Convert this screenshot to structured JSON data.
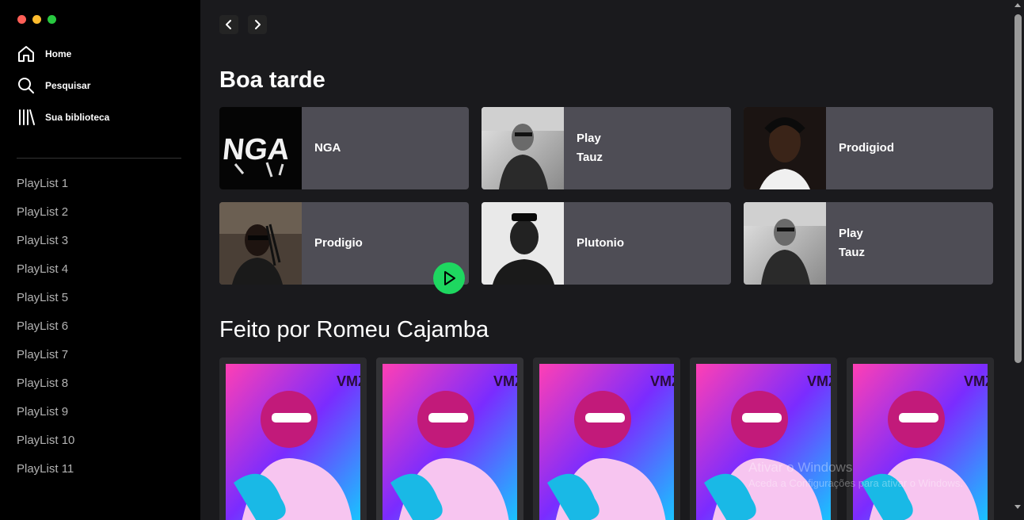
{
  "window": {
    "controls": [
      "close",
      "minimize",
      "maximize"
    ]
  },
  "sidebar": {
    "nav": [
      {
        "label": "Home",
        "icon": "home-icon"
      },
      {
        "label": "Pesquisar",
        "icon": "search-icon"
      },
      {
        "label": "Sua biblioteca",
        "icon": "library-icon"
      }
    ],
    "playlists": [
      "PlayList 1",
      "PlayList 2",
      "PlayList 3",
      "PlayList 4",
      "PlayList 5",
      "PlayList 6",
      "PlayList 7",
      "PlayList 8",
      "PlayList 9",
      "PlayList 10",
      "PlayList 11"
    ]
  },
  "main": {
    "greeting": "Boa tarde",
    "cards": [
      {
        "name": "NGA",
        "image": "nga-logo"
      },
      {
        "name": "Play\nTauz",
        "image": "tauz-portrait"
      },
      {
        "name": "Prodigiod",
        "image": "prodigio-portrait"
      },
      {
        "name": "Prodigio",
        "image": "prodigio-photo"
      },
      {
        "name": "Plutonio",
        "image": "plutonio-portrait"
      },
      {
        "name": "Play\nTauz",
        "image": "tauz-portrait"
      }
    ],
    "section_title": "Feito por Romeu Cajamba",
    "made_for_count_visible": 5
  },
  "watermark": {
    "line1": "Ativar o Windows",
    "line2": "Aceda a Configurações para ativar o Windows."
  },
  "colors": {
    "accent": "#1ed760",
    "card_bg": "#4e4d55",
    "sidebar_bg": "#000000",
    "main_bg": "#1a1a1d"
  }
}
